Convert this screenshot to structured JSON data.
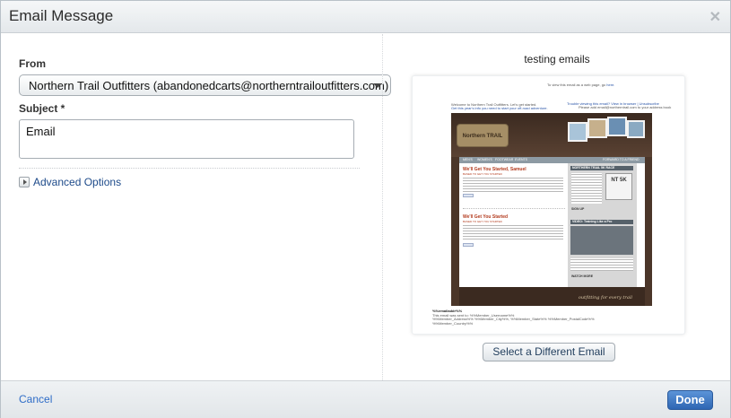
{
  "dialog": {
    "title": "Email Message",
    "close_icon": "close-icon"
  },
  "form": {
    "from_label": "From",
    "from_value": "Northern Trail Outfitters (abandonedcarts@northerntrailoutfitters.com)",
    "subject_label": "Subject *",
    "subject_value": "Email",
    "advanced_options": "Advanced Options"
  },
  "preview": {
    "title": "testing emails",
    "thumb": {
      "top_note": "To view this email as a web page, go",
      "top_link": "here.",
      "welcome": "Welcome to Northern Trail Outfitters. Let's get started.",
      "welcome_link": "Get this year's info you need to start your off-road adventure.",
      "right_link1": "Trouble viewing this email? View in browser",
      "right_link2": "Unsubscribe",
      "right_note": "Please add email@northerntrail.com to your address book",
      "logo": "Northern TRAIL",
      "nav": [
        "MEN'S",
        "WOMEN'S",
        "FOOTWEAR",
        "EVENTS"
      ],
      "nav_right": "FORWARD TO A FRIEND",
      "heading1": "We'll Get You Started, Samuel",
      "heading2": "We'll Get You Started",
      "subheading": "BASED TO GET YOU STARTED",
      "like": "Like",
      "race_title": "NORTHERN TRAIL 5K RACE",
      "race_badge": "NT 5K",
      "signup": "SIGN UP",
      "video_title": "VIDEO: Training Like a Pro",
      "watch": "WATCH MORE",
      "tagline": "outfitting for every trail",
      "personalization": "%%emailaddr%%",
      "footer_note": "This email was sent to: %%Member_Username%%",
      "footer_fields": "%%Member_Address%% %%Member_City%%, %%Member_State%% %%Member_PostalCode%% %%Member_Country%%"
    },
    "select_button": "Select a Different Email"
  },
  "footer": {
    "cancel": "Cancel",
    "done": "Done"
  },
  "colors": {
    "accent": "#2e66b3",
    "link": "#2e6cc7",
    "brand_brown": "#4b3629"
  }
}
